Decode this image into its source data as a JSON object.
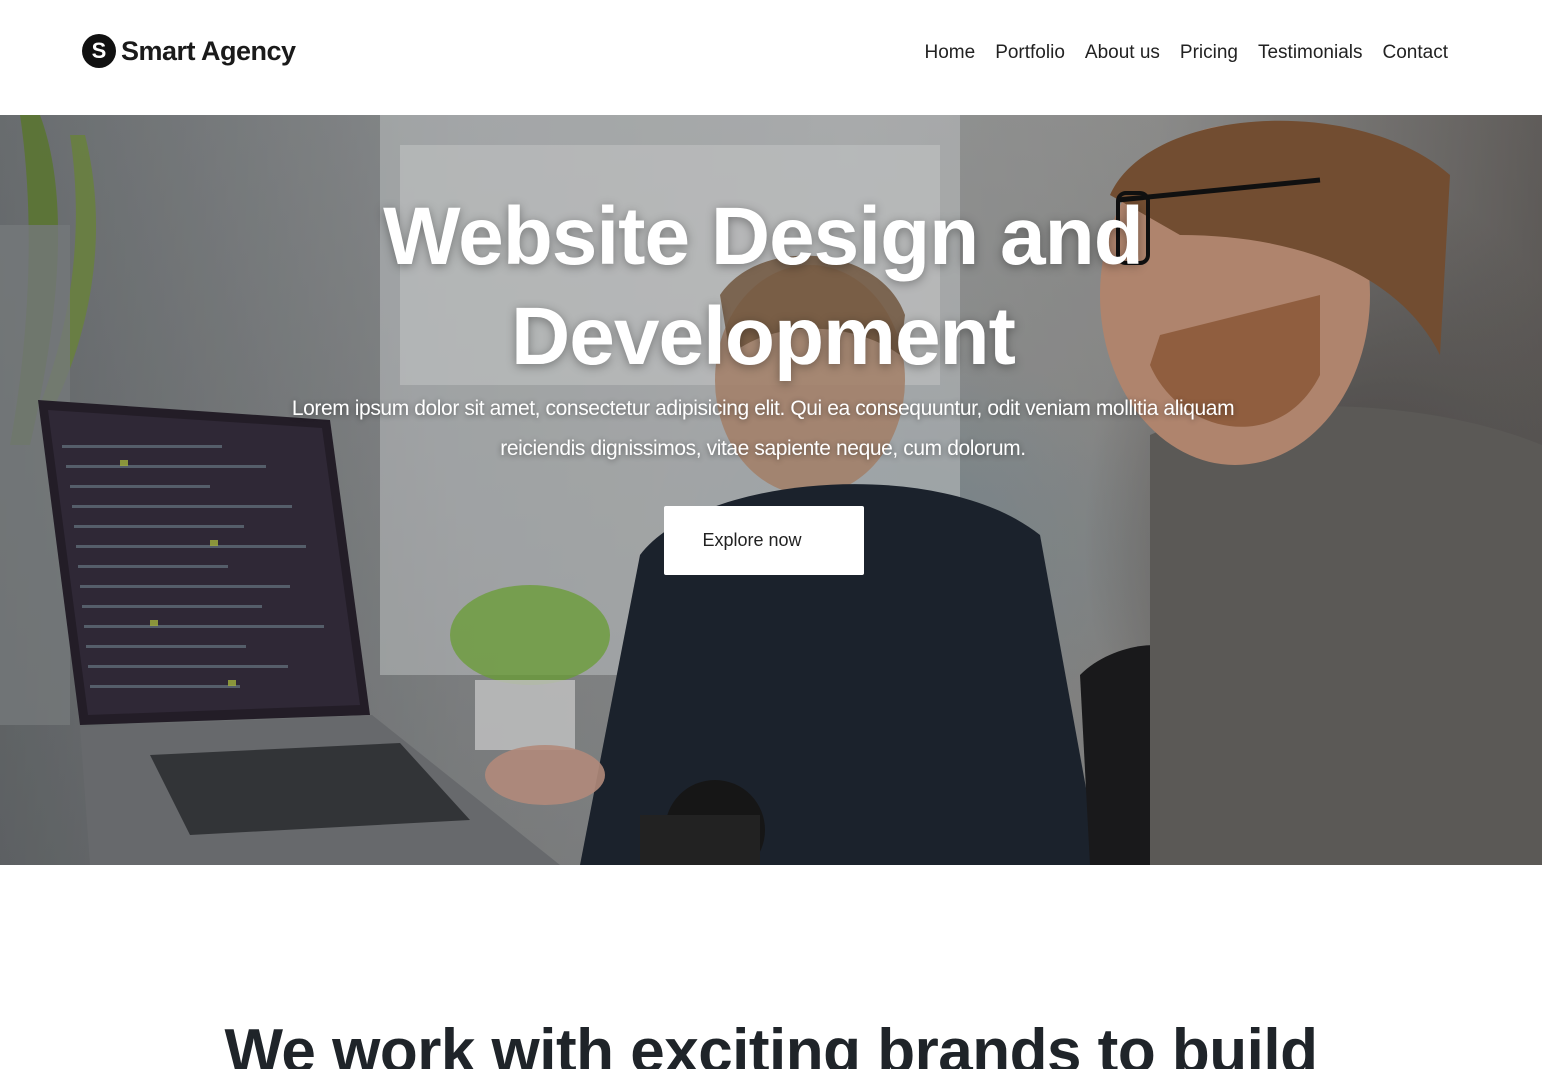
{
  "header": {
    "brand": {
      "logo_letter": "S",
      "name": "Smart Agency"
    },
    "nav": [
      {
        "label": "Home"
      },
      {
        "label": "Portfolio"
      },
      {
        "label": "About us"
      },
      {
        "label": "Pricing"
      },
      {
        "label": "Testimonials"
      },
      {
        "label": "Contact"
      }
    ]
  },
  "hero": {
    "title": "Website Design and Development",
    "subtitle": "Lorem ipsum dolor sit amet, consectetur adipisicing elit. Qui ea consequuntur, odit veniam mollitia aliquam reiciendis dignissimos, vitae sapiente neque, cum dolorum.",
    "cta_label": "Explore now",
    "background_image": "photo-two-developers-working-on-laptops"
  },
  "section": {
    "heading": "We work with exciting brands to build"
  },
  "colors": {
    "text_dark": "#1f2429",
    "hero_text": "#ffffff",
    "button_bg": "#ffffff"
  }
}
